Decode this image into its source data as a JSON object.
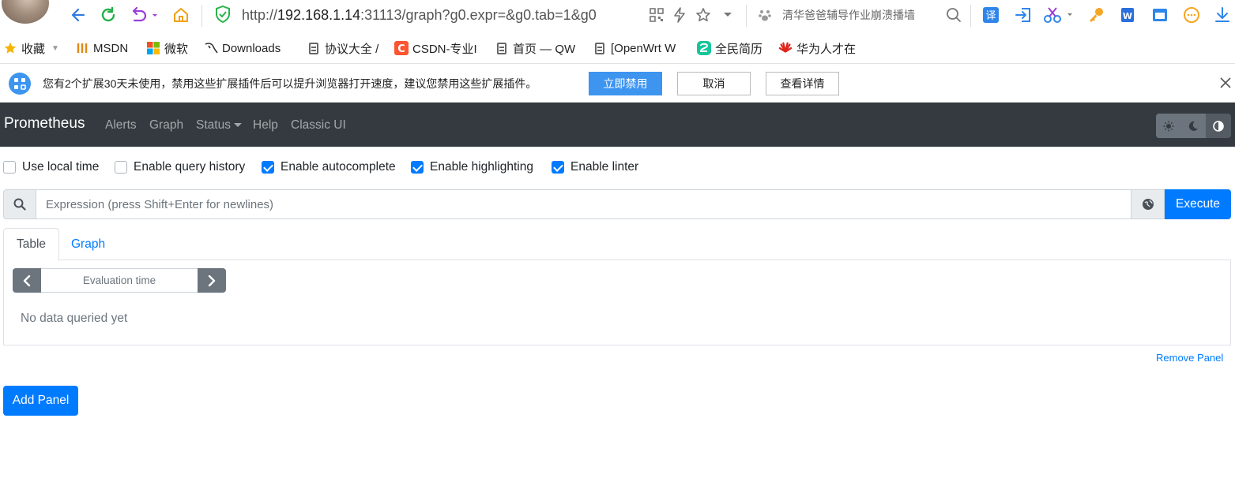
{
  "browser": {
    "url_prefix": "http://",
    "url_host": "192.168.1.14",
    "url_rest": ":31113/graph?g0.expr=&g0.tab=1&g0",
    "search_hint": "清华爸爸辅导作业崩溃播墙"
  },
  "bookmarks": [
    {
      "label": "收藏"
    },
    {
      "label": "MSDN"
    },
    {
      "label": "微软"
    },
    {
      "label": "Downloads"
    },
    {
      "label": "协议大全 /"
    },
    {
      "label": "CSDN-专业I"
    },
    {
      "label": "首页 — QW"
    },
    {
      "label": "[OpenWrt W"
    },
    {
      "label": "全民简历"
    },
    {
      "label": "华为人才在"
    }
  ],
  "notice": {
    "text": "您有2个扩展30天未使用，禁用这些扩展插件后可以提升浏览器打开速度，建议您禁用这些扩展插件。",
    "disable_now": "立即禁用",
    "cancel": "取消",
    "details": "查看详情"
  },
  "navbar": {
    "brand": "Prometheus",
    "links": [
      "Alerts",
      "Graph",
      "Status",
      "Help",
      "Classic UI"
    ]
  },
  "options": [
    {
      "label": "Use local time",
      "checked": false
    },
    {
      "label": "Enable query history",
      "checked": false
    },
    {
      "label": "Enable autocomplete",
      "checked": true
    },
    {
      "label": "Enable highlighting",
      "checked": true
    },
    {
      "label": "Enable linter",
      "checked": true
    }
  ],
  "expression": {
    "placeholder": "Expression (press Shift+Enter for newlines)",
    "execute": "Execute"
  },
  "tabs": [
    "Table",
    "Graph"
  ],
  "panel": {
    "eval_placeholder": "Evaluation time",
    "no_data": "No data queried yet",
    "remove": "Remove Panel"
  },
  "add_panel": "Add Panel",
  "colors": {
    "navbar": "#343a40",
    "primary": "#007bff",
    "secondary": "#6c757d"
  }
}
